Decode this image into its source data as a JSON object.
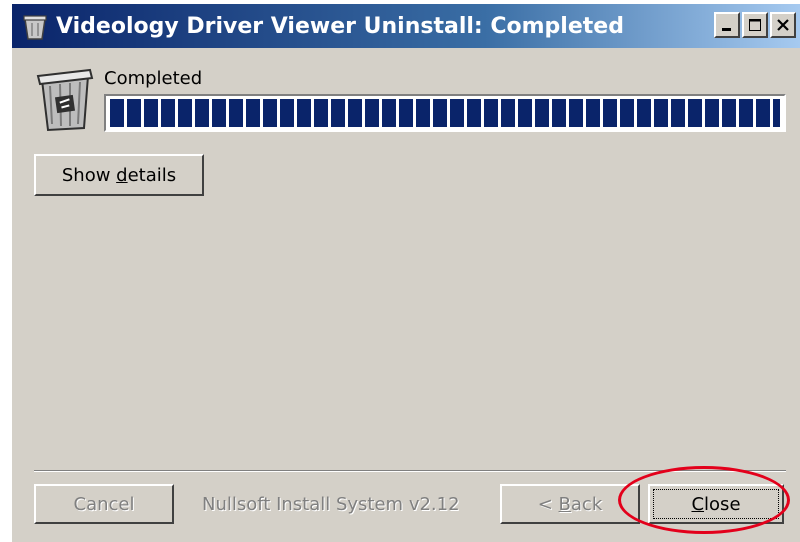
{
  "window": {
    "title": "Videology Driver Viewer Uninstall: Completed"
  },
  "title_buttons": [
    {
      "name": "minimize",
      "icon": "minimize-icon"
    },
    {
      "name": "maximize",
      "icon": "maximize-icon"
    },
    {
      "name": "close",
      "icon": "close-icon"
    }
  ],
  "status": {
    "label": "Completed",
    "progress_percent": 100
  },
  "buttons": {
    "show_details": {
      "pre": "Show ",
      "accel": "d",
      "post": "etails"
    },
    "cancel": "Cancel",
    "back": {
      "pre": "< ",
      "accel": "B",
      "post": "ack"
    },
    "close": {
      "pre": "",
      "accel": "C",
      "post": "lose"
    }
  },
  "branding": "Nullsoft Install System v2.12",
  "colors": {
    "titlebar_start": "#0a246a",
    "titlebar_end": "#a6caf0",
    "dialog_bg": "#d4d0c8",
    "progress_block": "#0a246a",
    "highlight_ellipse": "#e3001b"
  },
  "icons": {
    "title": "recycle-bin-icon",
    "header": "recycle-bin-icon"
  }
}
